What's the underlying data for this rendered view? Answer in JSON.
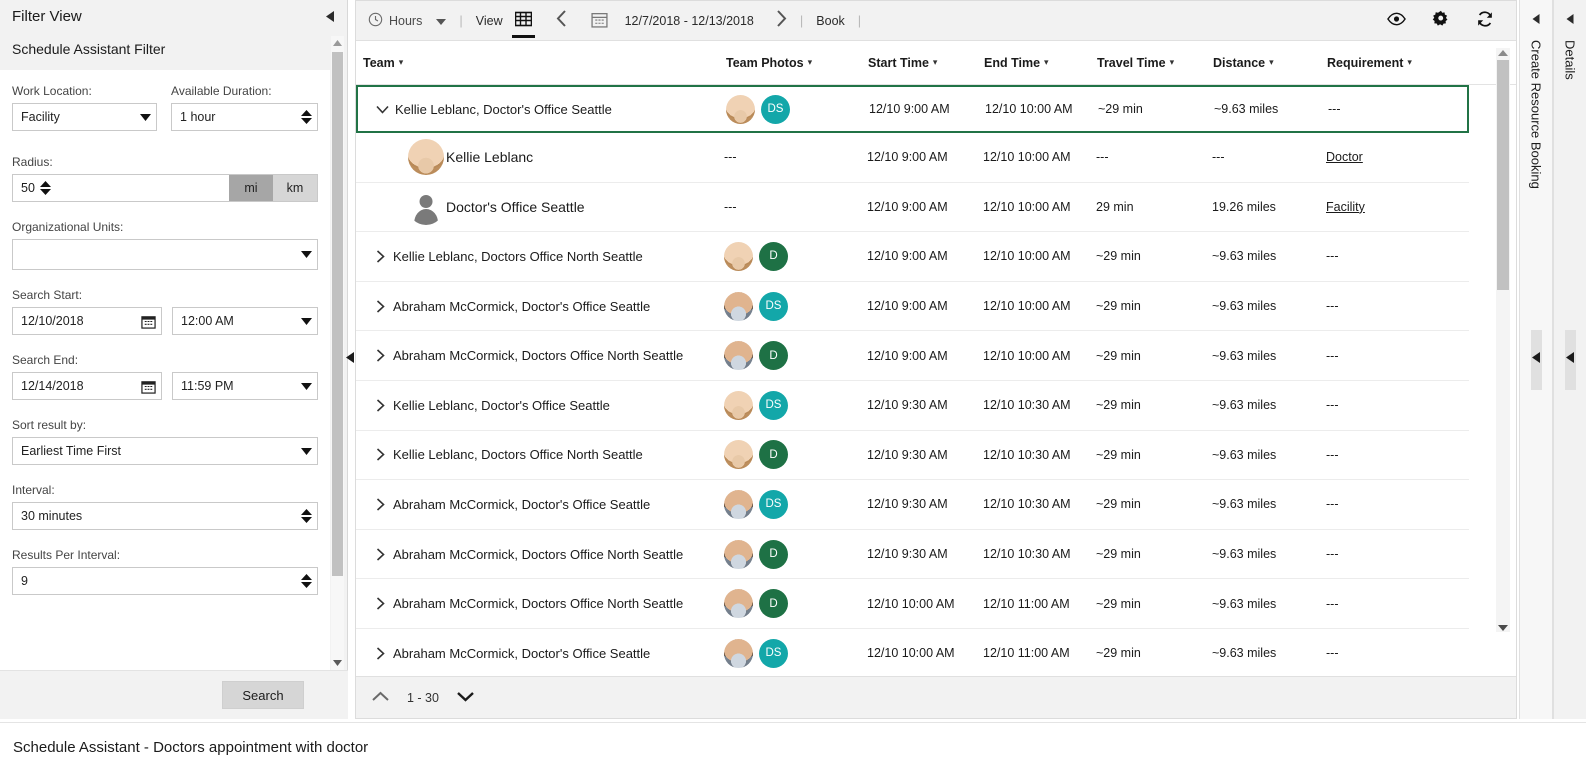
{
  "filter_panel": {
    "title": "Filter View",
    "subtitle": "Schedule Assistant Filter",
    "collapse_icon": "chevron-left-icon",
    "fields": {
      "work_location_label": "Work Location:",
      "work_location_value": "Facility",
      "available_duration_label": "Available Duration:",
      "available_duration_value": "1 hour",
      "radius_label": "Radius:",
      "radius_value": "50",
      "unit_mi": "mi",
      "unit_km": "km",
      "unit_selected": "mi",
      "org_units_label": "Organizational Units:",
      "org_units_value": "",
      "search_start_label": "Search Start:",
      "search_start_date": "12/10/2018",
      "search_start_time": "12:00 AM",
      "search_end_label": "Search End:",
      "search_end_date": "12/14/2018",
      "search_end_time": "11:59 PM",
      "sort_label": "Sort result by:",
      "sort_value": "Earliest Time First",
      "interval_label": "Interval:",
      "interval_value": "30 minutes",
      "results_per_interval_label": "Results Per Interval:",
      "results_per_interval_value": "9"
    },
    "search_button": "Search"
  },
  "toolbar": {
    "hours_label": "Hours",
    "hours_icon": "clock-icon",
    "hours_caret": "caret-down-icon",
    "view_label": "View",
    "grid_icon": "grid-view-icon",
    "prev_icon": "chevron-left-icon",
    "calendar_icon": "calendar-icon",
    "date_range": "12/7/2018 - 12/13/2018",
    "next_icon": "chevron-right-icon",
    "book_label": "Book",
    "eye_icon": "eye-icon",
    "gear_icon": "gear-icon",
    "refresh_icon": "refresh-icon",
    "separator": "|"
  },
  "grid": {
    "columns": [
      {
        "label": "Team",
        "sort_icon": "chevron-down-icon"
      },
      {
        "label": "Team Photos",
        "sort_icon": "chevron-down-icon"
      },
      {
        "label": "Start Time",
        "sort_icon": "chevron-down-icon"
      },
      {
        "label": "End Time",
        "sort_icon": "chevron-down-icon"
      },
      {
        "label": "Travel Time",
        "sort_icon": "chevron-down-icon"
      },
      {
        "label": "Distance",
        "sort_icon": "chevron-down-icon"
      },
      {
        "label": "Requirement",
        "sort_icon": "chevron-down-icon"
      }
    ],
    "rows": [
      {
        "kind": "parent",
        "selected": true,
        "expanded": true,
        "twisty": "chevron-down-icon",
        "team": "Kellie Leblanc, Doctor's Office Seattle",
        "avatar": "female",
        "badge_text": "DS",
        "badge_color": "#13a7a9",
        "start_time": "12/10 9:00 AM",
        "end_time": "12/10 10:00 AM",
        "travel_time": "~29 min",
        "distance": "~9.63 miles",
        "requirement": "---",
        "requirement_link": false
      },
      {
        "kind": "child",
        "selected": false,
        "team": "Kellie Leblanc",
        "avatar": "female",
        "photos": "---",
        "start_time": "12/10 9:00 AM",
        "end_time": "12/10 10:00 AM",
        "travel_time": "---",
        "distance": "---",
        "requirement": "Doctor",
        "requirement_link": true
      },
      {
        "kind": "child",
        "selected": false,
        "team": "Doctor's Office Seattle",
        "avatar": "anon",
        "photos": "---",
        "start_time": "12/10 9:00 AM",
        "end_time": "12/10 10:00 AM",
        "travel_time": "29 min",
        "distance": "19.26 miles",
        "requirement": "Facility",
        "requirement_link": true
      },
      {
        "kind": "parent",
        "selected": false,
        "expanded": false,
        "twisty": "chevron-right-icon",
        "team": "Kellie Leblanc, Doctors Office North Seattle",
        "avatar": "female",
        "badge_text": "D",
        "badge_color": "#1e7145",
        "start_time": "12/10 9:00 AM",
        "end_time": "12/10 10:00 AM",
        "travel_time": "~29 min",
        "distance": "~9.63 miles",
        "requirement": "---",
        "requirement_link": false
      },
      {
        "kind": "parent",
        "selected": false,
        "expanded": false,
        "twisty": "chevron-right-icon",
        "team": "Abraham McCormick, Doctor's Office Seattle",
        "avatar": "male",
        "badge_text": "DS",
        "badge_color": "#13a7a9",
        "start_time": "12/10 9:00 AM",
        "end_time": "12/10 10:00 AM",
        "travel_time": "~29 min",
        "distance": "~9.63 miles",
        "requirement": "---",
        "requirement_link": false
      },
      {
        "kind": "parent",
        "selected": false,
        "expanded": false,
        "twisty": "chevron-right-icon",
        "team": "Abraham McCormick, Doctors Office North Seattle",
        "avatar": "male",
        "badge_text": "D",
        "badge_color": "#1e7145",
        "start_time": "12/10 9:00 AM",
        "end_time": "12/10 10:00 AM",
        "travel_time": "~29 min",
        "distance": "~9.63 miles",
        "requirement": "---",
        "requirement_link": false
      },
      {
        "kind": "parent",
        "selected": false,
        "expanded": false,
        "twisty": "chevron-right-icon",
        "team": "Kellie Leblanc, Doctor's Office Seattle",
        "avatar": "female",
        "badge_text": "DS",
        "badge_color": "#13a7a9",
        "start_time": "12/10 9:30 AM",
        "end_time": "12/10 10:30 AM",
        "travel_time": "~29 min",
        "distance": "~9.63 miles",
        "requirement": "---",
        "requirement_link": false
      },
      {
        "kind": "parent",
        "selected": false,
        "expanded": false,
        "twisty": "chevron-right-icon",
        "team": "Kellie Leblanc, Doctors Office North Seattle",
        "avatar": "female",
        "badge_text": "D",
        "badge_color": "#1e7145",
        "start_time": "12/10 9:30 AM",
        "end_time": "12/10 10:30 AM",
        "travel_time": "~29 min",
        "distance": "~9.63 miles",
        "requirement": "---",
        "requirement_link": false
      },
      {
        "kind": "parent",
        "selected": false,
        "expanded": false,
        "twisty": "chevron-right-icon",
        "team": "Abraham McCormick, Doctor's Office Seattle",
        "avatar": "male",
        "badge_text": "DS",
        "badge_color": "#13a7a9",
        "start_time": "12/10 9:30 AM",
        "end_time": "12/10 10:30 AM",
        "travel_time": "~29 min",
        "distance": "~9.63 miles",
        "requirement": "---",
        "requirement_link": false
      },
      {
        "kind": "parent",
        "selected": false,
        "expanded": false,
        "twisty": "chevron-right-icon",
        "team": "Abraham McCormick, Doctors Office North Seattle",
        "avatar": "male",
        "badge_text": "D",
        "badge_color": "#1e7145",
        "start_time": "12/10 9:30 AM",
        "end_time": "12/10 10:30 AM",
        "travel_time": "~29 min",
        "distance": "~9.63 miles",
        "requirement": "---",
        "requirement_link": false
      },
      {
        "kind": "parent",
        "selected": false,
        "expanded": false,
        "twisty": "chevron-right-icon",
        "team": "Abraham McCormick, Doctors Office North Seattle",
        "avatar": "male",
        "badge_text": "D",
        "badge_color": "#1e7145",
        "start_time": "12/10 10:00 AM",
        "end_time": "12/10 11:00 AM",
        "travel_time": "~29 min",
        "distance": "~9.63 miles",
        "requirement": "---",
        "requirement_link": false
      },
      {
        "kind": "parent",
        "selected": false,
        "expanded": false,
        "twisty": "chevron-right-icon",
        "team": "Abraham McCormick, Doctor's Office Seattle",
        "avatar": "male",
        "badge_text": "DS",
        "badge_color": "#13a7a9",
        "start_time": "12/10 10:00 AM",
        "end_time": "12/10 11:00 AM",
        "travel_time": "~29 min",
        "distance": "~9.63 miles",
        "requirement": "---",
        "requirement_link": false
      }
    ]
  },
  "pagination": {
    "up_icon": "chevron-up-icon",
    "range": "1 - 30",
    "down_icon": "chevron-down-icon"
  },
  "rails": {
    "create_booking": "Create Resource Booking",
    "details": "Details",
    "collapse_icon": "chevron-left-icon"
  },
  "status_bar": {
    "text": "Schedule Assistant - Doctors appointment with doctor"
  },
  "colors": {
    "selection_green": "#217346",
    "badge_teal": "#13a7a9",
    "badge_green": "#1e7145",
    "panel_gray": "#f2f2f2"
  }
}
